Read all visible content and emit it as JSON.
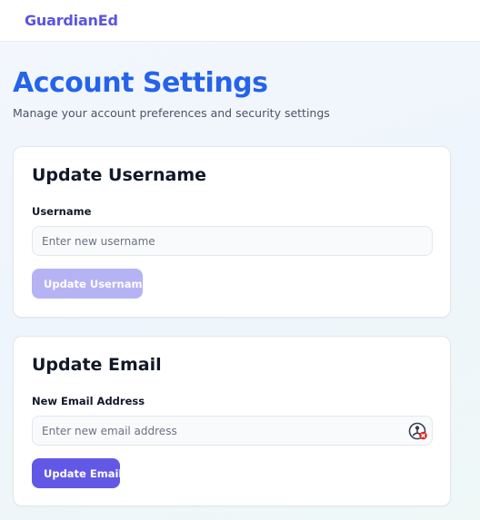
{
  "header": {
    "brand": "GuardianEd"
  },
  "page": {
    "title": "Account Settings",
    "subtitle": "Manage your account preferences and security settings"
  },
  "username_card": {
    "title": "Update Username",
    "field_label": "Username",
    "input_value": "",
    "input_placeholder": "Enter new username",
    "button_label": "Update Username",
    "button_state": "disabled"
  },
  "email_card": {
    "title": "Update Email",
    "field_label": "New Email Address",
    "input_value": "",
    "input_placeholder": "Enter new email address",
    "input_icon": "password-manager-icon",
    "button_label": "Update Email",
    "button_state": "enabled"
  },
  "colors": {
    "brand": "#5b54e0",
    "title": "#2563eb",
    "primary_button": "#6258e6",
    "disabled_button": "#b6b3f5"
  }
}
